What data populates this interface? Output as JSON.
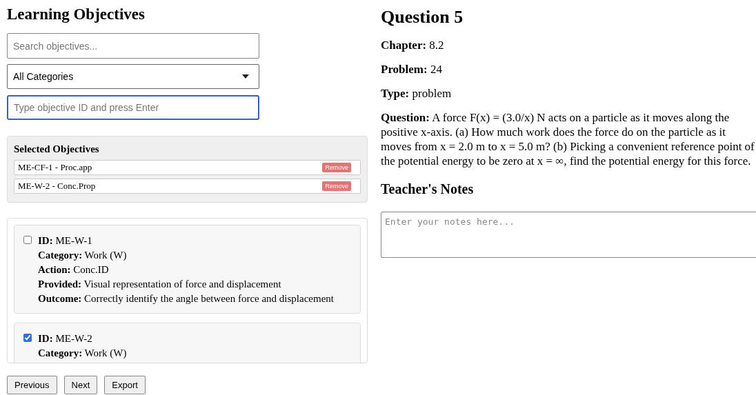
{
  "left": {
    "title": "Learning Objectives",
    "search": {
      "placeholder": "Search objectives..."
    },
    "category_select": {
      "value": "All Categories"
    },
    "id_input": {
      "placeholder": "Type objective ID and press Enter",
      "focused": true
    },
    "selected_panel": {
      "title": "Selected Objectives",
      "items": [
        {
          "label": "ME-CF-1 - Proc.app",
          "button": "Remove"
        },
        {
          "label": "ME-W-2 - Conc.Prop",
          "button": "Remove"
        }
      ]
    },
    "objectives": [
      {
        "checked": false,
        "lines": [
          "**ID:** ME-W-1",
          "**Category:** Work (W)",
          "**Action:** Conc.ID",
          "**Provided:** Visual representation of force and displacement",
          "**Outcome:** Correctly identify the angle between force and displacement"
        ]
      },
      {
        "checked": true,
        "lines": [
          "**ID:** ME-W-2",
          "**Category:** Work (W)"
        ]
      }
    ],
    "buttons": [
      "Previous",
      "Next",
      "Export"
    ]
  },
  "right": {
    "title": "Question 5",
    "fields": [
      "**Chapter:** 8.2",
      "**Problem:** 24",
      "**Type:** problem",
      "**Question:** A force F(x) = (3.0/x) N acts on a particle as it moves along the positive x-axis. (a) How much work does the force do on the particle as it moves from x = 2.0 m to x = 5.0 m? (b) Picking a convenient reference point of the potential energy to be zero at x = ∞, find the potential energy for this force."
    ],
    "notes": {
      "title": "Teacher's Notes",
      "placeholder": "Enter your notes here..."
    }
  }
}
